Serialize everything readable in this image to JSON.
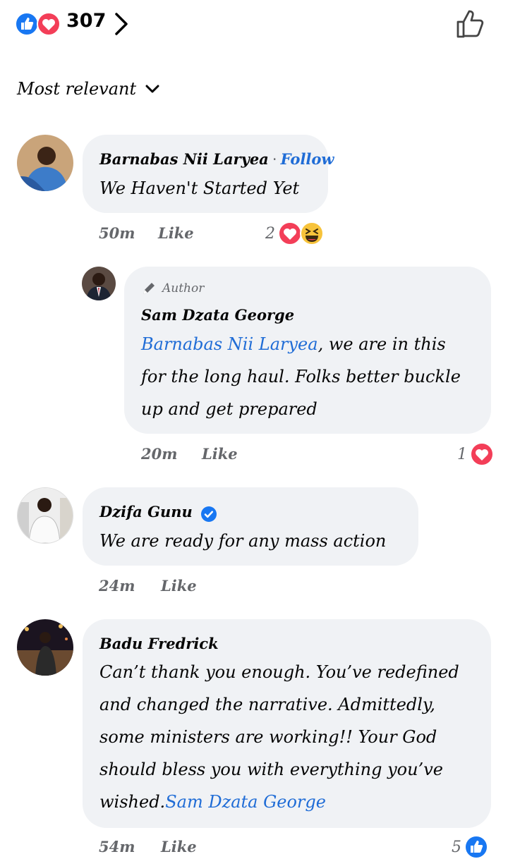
{
  "header": {
    "reaction_count": "307",
    "reaction_icons": [
      "like-icon",
      "love-icon"
    ]
  },
  "sort": {
    "label": "Most relevant"
  },
  "comments": [
    {
      "name": "Barnabas Nii Laryea",
      "separator": "·",
      "follow_label": "Follow",
      "text": "We Haven't Started Yet",
      "time": "50m",
      "like_label": "Like",
      "reaction_count": "2",
      "reaction_icons": [
        "love-icon",
        "haha-icon"
      ]
    },
    {
      "author_tag": "Author",
      "name": "Sam Dzata George",
      "mention": "Barnabas Nii Laryea",
      "text_line1_rest": ", we are in this",
      "text_line2": "for the long haul. Folks better buckle",
      "text_line3": "up and get prepared",
      "time": "20m",
      "like_label": "Like",
      "reaction_count": "1",
      "reaction_icons": [
        "love-icon"
      ]
    },
    {
      "name": "Dzifa Gunu",
      "verified": true,
      "text": "We are ready for any mass action",
      "time": "24m",
      "like_label": "Like"
    },
    {
      "name": "Badu Fredrick",
      "text_line1": "Can’t thank you enough. You’ve redefined",
      "text_line2": "and changed the narrative. Admittedly,",
      "text_line3": "some ministers are working!! Your God",
      "text_line4": "should bless you with everything you’ve",
      "text_line5_start": "wished.",
      "mention": "Sam Dzata George",
      "time": "54m",
      "like_label": "Like",
      "reaction_count": "5",
      "reaction_icons": [
        "like-icon"
      ]
    }
  ],
  "colors": {
    "link": "#1f6cd6",
    "bubble": "#f0f2f5",
    "meta": "#65676b",
    "love": "#f33e58",
    "like": "#1877f2"
  }
}
